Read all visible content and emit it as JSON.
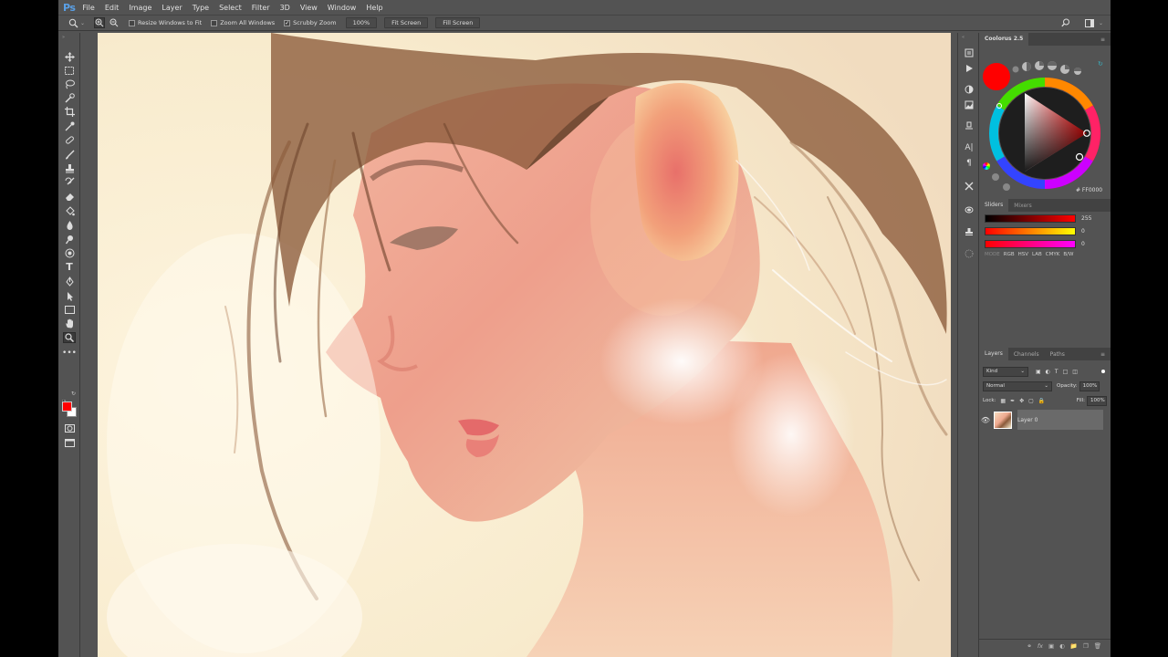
{
  "app": {
    "logo": "Ps"
  },
  "menu": [
    "File",
    "Edit",
    "Image",
    "Layer",
    "Type",
    "Select",
    "Filter",
    "3D",
    "View",
    "Window",
    "Help"
  ],
  "options": {
    "resize_windows": "Resize Windows to Fit",
    "zoom_all": "Zoom All Windows",
    "scrubby": "Scrubby Zoom",
    "zoom_value": "100%",
    "fit_screen": "Fit Screen",
    "fill_screen": "Fill Screen"
  },
  "color_panel": {
    "title": "Coolorus 2.5",
    "hex": "# FF0000",
    "tabs": [
      "Sliders",
      "Mixers"
    ],
    "sliders": [
      "255",
      "0",
      "0"
    ],
    "modes": [
      "MODE",
      "RGB",
      "HSV",
      "LAB",
      "CMYK",
      "B/W"
    ]
  },
  "layers_panel": {
    "tabs": [
      "Layers",
      "Channels",
      "Paths"
    ],
    "kind": "Kind",
    "blend": "Normal",
    "opacity_label": "Opacity:",
    "opacity": "100%",
    "lock_label": "Lock:",
    "fill_label": "Fill:",
    "fill": "100%",
    "layer_name": "Layer 0"
  },
  "colors": {
    "foreground": "#ff0000",
    "background": "#ffffff",
    "accent": "#5aa0e6"
  }
}
